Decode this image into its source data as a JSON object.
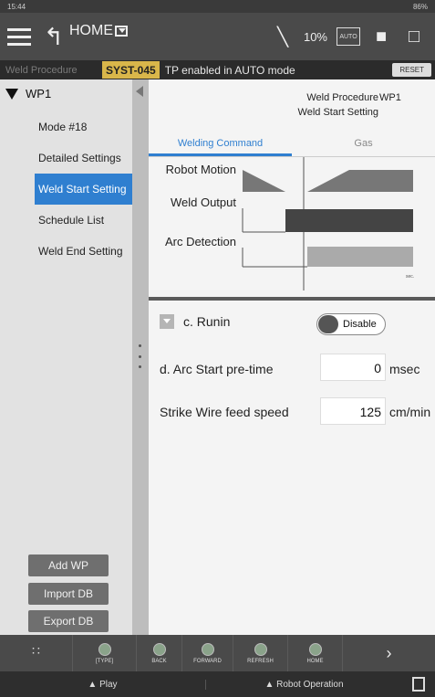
{
  "status_bar": {
    "time": "15:44",
    "battery": "86%"
  },
  "app_bar": {
    "title": "HOME",
    "speed": "10%",
    "auto_label": "AUTO"
  },
  "message_bar": {
    "source": "Weld Procedure",
    "code": "SYST-045",
    "text": "TP enabled in AUTO mode",
    "reset_label": "RESET"
  },
  "tree": {
    "root": "WP1",
    "items": [
      {
        "label": "Mode #18",
        "selected": false
      },
      {
        "label": "Detailed Settings",
        "selected": false
      },
      {
        "label": "Weld Start Setting",
        "selected": true
      },
      {
        "label": "Schedule List",
        "selected": false
      },
      {
        "label": "Weld End Setting",
        "selected": false
      }
    ]
  },
  "left_buttons": {
    "add_wp": "Add WP",
    "import_db": "Import DB",
    "export_db": "Export DB"
  },
  "header": {
    "procedure_label": "Weld Procedure",
    "procedure_value": "WP1",
    "subtitle": "Weld Start Setting"
  },
  "tabs": [
    {
      "label": "Welding Command",
      "active": true
    },
    {
      "label": "Gas",
      "active": false
    }
  ],
  "diagram": {
    "robot_motion": "Robot Motion",
    "weld_output": "Weld Output",
    "arc_detection": "Arc Detection",
    "unit": "sec."
  },
  "form": {
    "runin_label": "c. Runin",
    "runin_toggle": "Disable",
    "arc_start_label": "d. Arc Start pre-time",
    "arc_start_value": "0",
    "arc_start_unit": "msec",
    "strike_label": "Strike Wire feed speed",
    "strike_value": "125",
    "strike_unit": "cm/min"
  },
  "toolbar": {
    "type": "[TYPE]",
    "back": "BACK",
    "forward": "FORWARD",
    "refresh": "REFRESH",
    "home": "HOME"
  },
  "bottom_bar": {
    "play": "▲ Play",
    "robot_operation": "▲ Robot Operation"
  }
}
